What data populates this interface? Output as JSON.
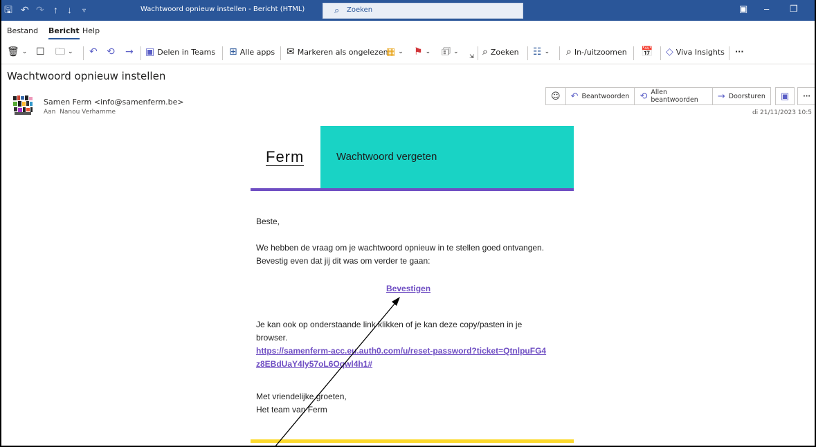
{
  "window": {
    "title": "Wachtwoord opnieuw instellen  -  Bericht (HTML)",
    "search_placeholder": "Zoeken"
  },
  "menu": [
    "Bestand",
    "Bericht",
    "Help"
  ],
  "ribbon": {
    "share_teams": "Delen in Teams",
    "all_apps": "Alle apps",
    "mark_unread": "Markeren als ongelezen",
    "search": "Zoeken",
    "zoom": "In-/uitzoomen",
    "viva": "Viva Insights",
    "more": "···"
  },
  "message": {
    "subject": "Wachtwoord opnieuw instellen",
    "sender": "Samen Ferm <info@samenferm.be>",
    "to_label": "Aan",
    "to_name": "Nanou Verhamme",
    "date": "di 21/11/2023 10:5",
    "actions": {
      "reply": "Beantwoorden",
      "reply_all": "Allen beantwoorden",
      "forward": "Doorsturen"
    }
  },
  "email": {
    "logo": "Ferm",
    "header_title": "Wachtwoord vergeten",
    "greeting": "Beste,",
    "paragraph1": "We hebben de vraag om je wachtwoord opnieuw in te stellen goed ontvangen. Bevestig even dat jij dit was om verder te gaan:",
    "confirm_label": "Bevestigen",
    "paragraph2": "Je kan ook op onderstaande link klikken of je kan deze copy/pasten in je browser.",
    "link": "https://samenferm-acc.eu.auth0.com/u/reset-password?ticket=QtnlpuFG4z8EBdUaY4ly57oL6Oqwl4h1#",
    "closing": "Met vriendelijke groeten,",
    "signature": "Het team van Ferm"
  },
  "colors": {
    "titlebar": "#2a5699",
    "teal": "#19d3c5",
    "purple": "#6f4ec3",
    "yellow": "#fcd92b"
  }
}
